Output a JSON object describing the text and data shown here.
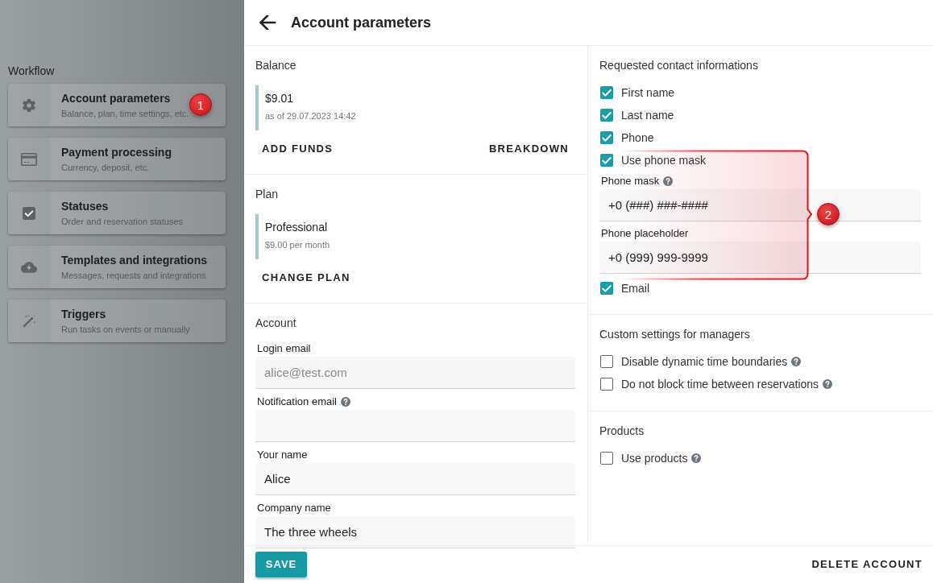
{
  "sidebar": {
    "heading": "Workflow",
    "items": [
      {
        "title": "Account parameters",
        "subtitle": "Balance, plan, time settings, etc.",
        "badge": "1"
      },
      {
        "title": "Payment processing",
        "subtitle": "Currency, deposit, etc."
      },
      {
        "title": "Statuses",
        "subtitle": "Order and reservation statuses"
      },
      {
        "title": "Templates and integrations",
        "subtitle": "Messages, requests and integrations"
      },
      {
        "title": "Triggers",
        "subtitle": "Run tasks on events or manually"
      }
    ]
  },
  "header": {
    "title": "Account parameters"
  },
  "balance": {
    "title": "Balance",
    "amount": "$9.01",
    "as_of": "as of 29.07.2023 14:42",
    "actions": [
      "ADD FUNDS",
      "BREAKDOWN"
    ]
  },
  "plan": {
    "title": "Plan",
    "name": "Professional",
    "price": "$9.00 per month",
    "actions": [
      "CHANGE PLAN"
    ]
  },
  "account": {
    "title": "Account",
    "fields": [
      {
        "label": "Login email",
        "value": "alice@test.com",
        "disabled": true
      },
      {
        "label": "Notification email",
        "help": true,
        "disabled": false
      },
      {
        "label": "Your name",
        "value": "Alice",
        "disabled": false
      },
      {
        "label": "Company name",
        "value": "The three wheels",
        "disabled": false
      }
    ]
  },
  "contact_info": {
    "title": "Requested contact informations",
    "options": [
      {
        "label": "First name",
        "checked": true
      },
      {
        "label": "Last name",
        "checked": true
      },
      {
        "label": "Phone",
        "checked": true
      },
      {
        "label": "Use phone mask",
        "checked": true,
        "fields": [
          {
            "label": "Phone mask",
            "help": true,
            "value": "+0 (###) ###-####"
          },
          {
            "label": "Phone placeholder",
            "value": "+0 (999) 999-9999"
          }
        ]
      },
      {
        "label": "Email",
        "checked": true
      }
    ],
    "callout": {
      "badge": "2"
    }
  },
  "manager_settings": {
    "title": "Custom settings for managers",
    "options": [
      {
        "label": "Disable dynamic time boundaries",
        "checked": false,
        "help": true
      },
      {
        "label": "Do not block time between reservations",
        "checked": false,
        "help": true
      }
    ]
  },
  "products": {
    "title": "Products",
    "options": [
      {
        "label": "Use products",
        "checked": false,
        "help": true
      }
    ]
  },
  "footer": {
    "save": "SAVE",
    "delete": "DELETE ACCOUNT"
  }
}
